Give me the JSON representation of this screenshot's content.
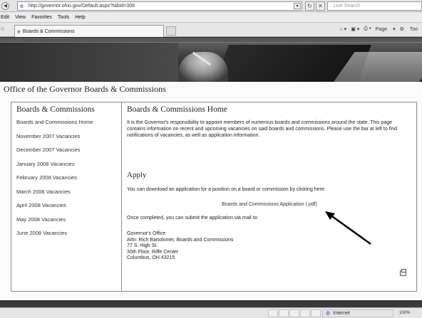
{
  "browser": {
    "url": "http://governor.ohio.gov/Default.aspx?tabid=309",
    "search_placeholder": "Live Search",
    "menu": [
      "Edit",
      "View",
      "Favorites",
      "Tools",
      "Help"
    ],
    "tab_title": "Boards & Commissions",
    "commands": {
      "page": "Page",
      "tools": "Too"
    },
    "status_zone": "Internet",
    "zoom": "100%"
  },
  "page": {
    "title": "Office of the Governor Boards & Commissions",
    "sidebar": {
      "heading": "Boards & Commissions",
      "items": [
        "Boards and Commissions Home",
        "November 2007 Vacancies",
        "December 2007 Vacancies",
        "January 2008 Vacancies",
        "February 2008 Vacancies",
        "March 2008 Vacancies",
        "April 2008 Vacancies",
        "May 2008 Vacancies",
        "June 2008 Vacancies"
      ]
    },
    "main": {
      "heading": "Boards & Commissions Home",
      "intro": "It is the Governor's responsibility to appoint members of numerous boards and commissions around the state. This page contains information on recent and upcoming vacancies on said boards and commissions. Please use the bar at left to find notifications of vacancies, as well as application information.",
      "apply_heading": "Apply",
      "apply_text": "You can download an application for a position on a board or commission by clicking here:",
      "application_link": "Boards and Commissions Application (.pdf)",
      "mail_text": "Once completed, you can submit the application via mail to:",
      "address": [
        "Governor's Office",
        "Attn: Rich Bartolomei, Boards and Commissions",
        "77 S. High St.",
        "30th Floor, Riffe Center",
        "Columbus, OH 43215"
      ]
    }
  },
  "icons": {
    "back": "back-arrow-icon",
    "browser": "ie-logo-icon",
    "print": "printer-icon",
    "annotation": "arrow-icon"
  }
}
